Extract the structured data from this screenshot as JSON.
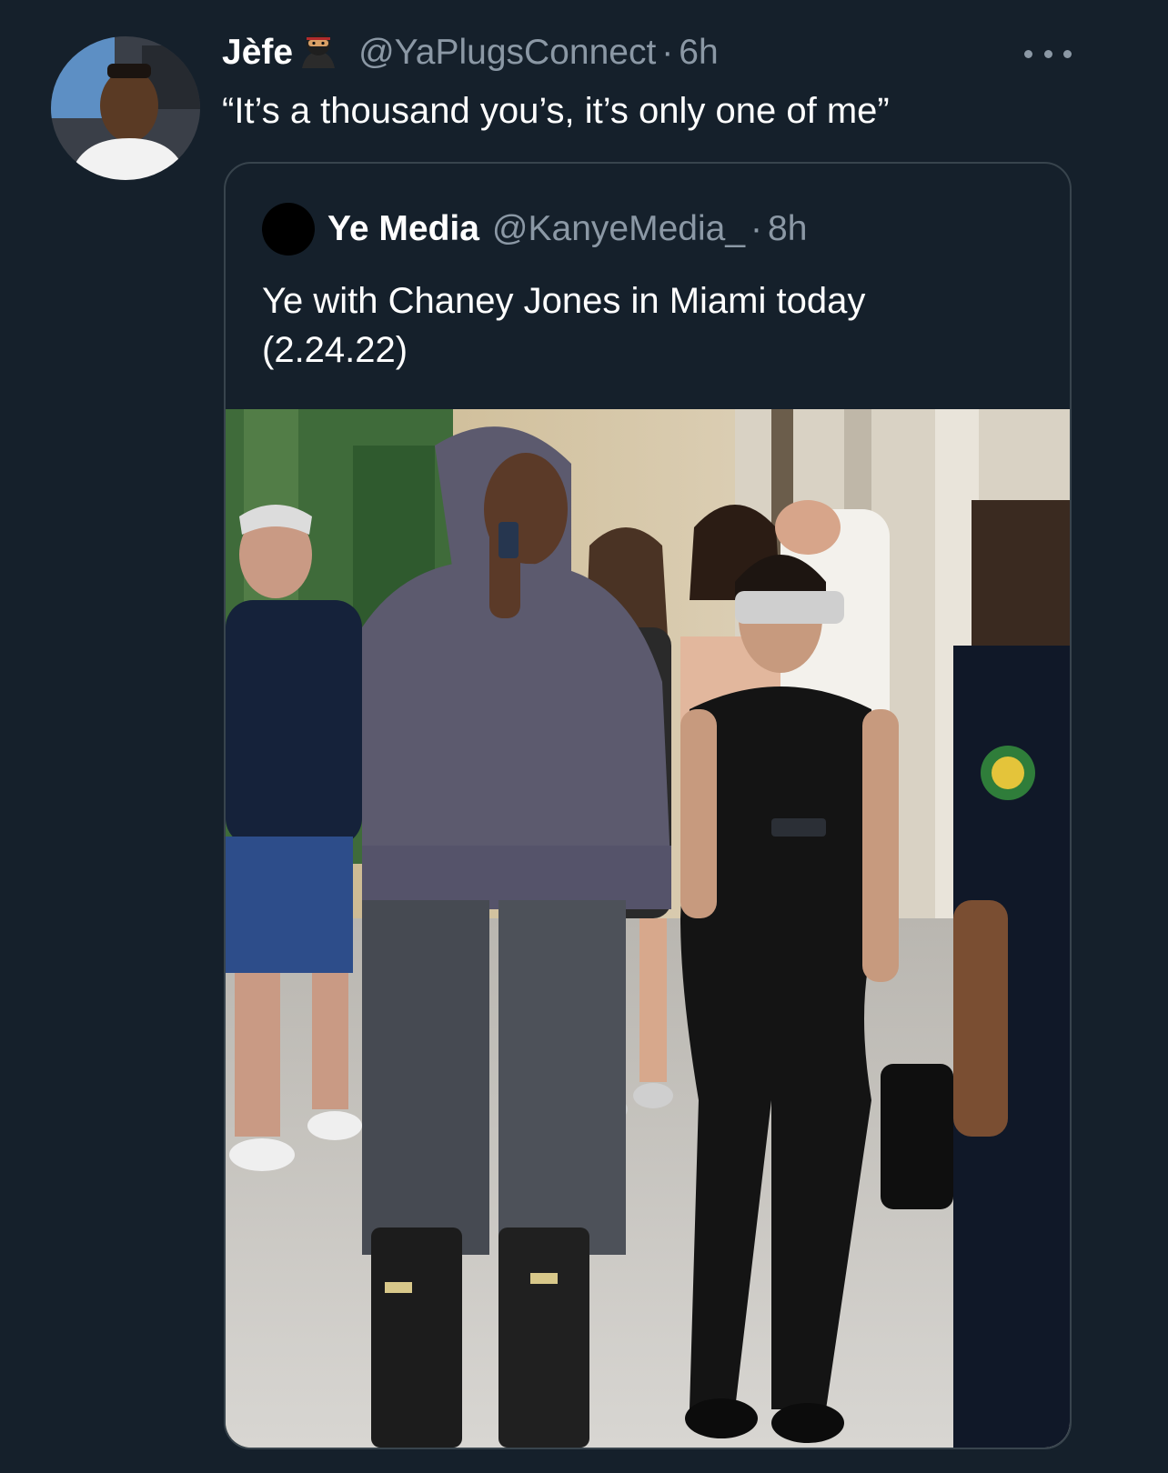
{
  "tweet": {
    "author": {
      "display_name": "Jèfe",
      "badge_emoji": "🥷",
      "handle": "@YaPlugsConnect",
      "separator": "·",
      "time": "6h"
    },
    "text": "“It’s a thousand you’s, it’s only one of me”",
    "more_icon": "more-horizontal-icon"
  },
  "quoted_tweet": {
    "author": {
      "display_name": "Ye Media",
      "handle": "@KanyeMedia_",
      "separator": "·",
      "time": "8h"
    },
    "text_line1": "Ye with Chaney Jones in Miami today",
    "text_line2": "(2.24.22)"
  },
  "theme": {
    "background": "#15202b",
    "primary_text": "#ffffff",
    "secondary_text": "#8b98a5",
    "border": "#38444d"
  }
}
